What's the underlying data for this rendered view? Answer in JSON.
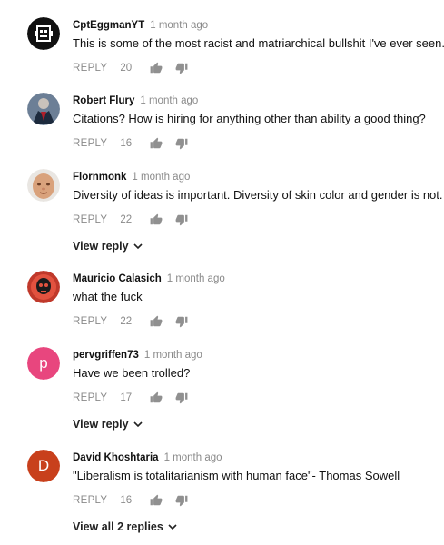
{
  "ui": {
    "reply_label": "REPLY",
    "colors": {
      "secondary_text": "#8a8a8a",
      "icon": "#909090"
    }
  },
  "comments": [
    {
      "author": "CptEggmanYT",
      "time": "1 month ago",
      "text": "This is some of the most racist and matriarchical bullshit I've ever seen.",
      "likes": "20",
      "avatar": {
        "kind": "image",
        "icon": "pixel-skull-avatar"
      }
    },
    {
      "author": "Robert Flury",
      "time": "1 month ago",
      "text": "Citations? How is hiring for anything other than ability a good thing?",
      "likes": "16",
      "avatar": {
        "kind": "image",
        "icon": "suited-figure-avatar"
      }
    },
    {
      "author": "Flornmonk",
      "time": "1 month ago",
      "text": "Diversity of ideas is important. Diversity of skin color and gender is not.",
      "likes": "22",
      "avatar": {
        "kind": "image",
        "icon": "bald-face-avatar"
      },
      "view_replies": "View reply"
    },
    {
      "author": "Mauricio Calasich",
      "time": "1 month ago",
      "text": "what the fuck",
      "likes": "22",
      "avatar": {
        "kind": "image",
        "icon": "red-skull-avatar"
      }
    },
    {
      "author": "pervgriffen73",
      "time": "1 month ago",
      "text": "Have we been trolled?",
      "likes": "17",
      "avatar": {
        "kind": "letter",
        "letter": "p",
        "color": "#e8467e"
      },
      "view_replies": "View reply"
    },
    {
      "author": "David Khoshtaria",
      "time": "1 month ago",
      "text": "\"Liberalism is totalitarianism with human face\"- Thomas Sowell",
      "likes": "16",
      "avatar": {
        "kind": "letter",
        "letter": "D",
        "color": "#c8401c"
      },
      "view_replies": "View all 2 replies"
    }
  ]
}
